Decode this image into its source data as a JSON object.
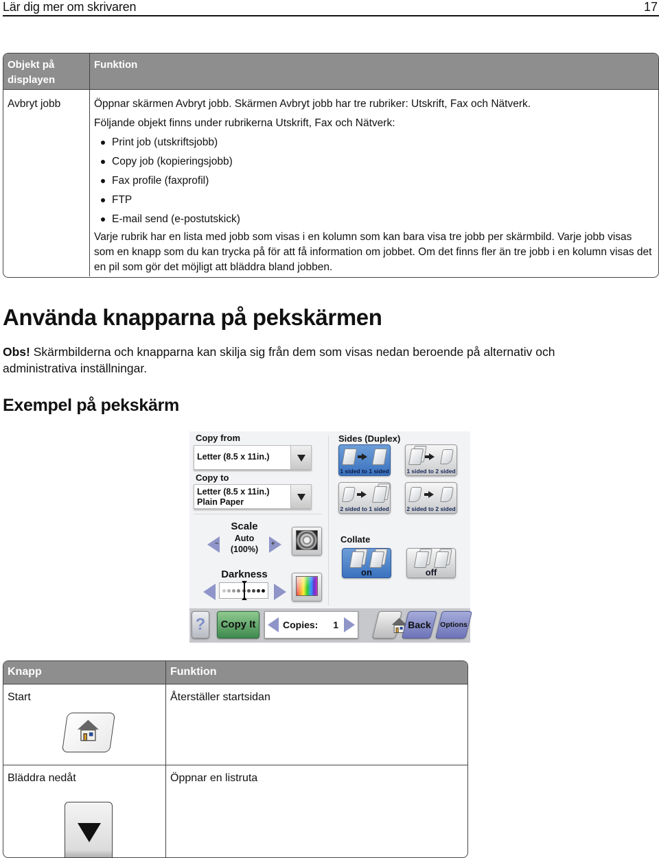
{
  "header": {
    "title": "Lär dig mer om skrivaren",
    "page_number": "17"
  },
  "table1": {
    "columns": [
      "Objekt på displayen",
      "Funktion"
    ],
    "rows": [
      {
        "item": "Avbryt jobb",
        "intro": "Öppnar skärmen Avbryt jobb. Skärmen Avbryt jobb har tre rubriker: Utskrift, Fax och Nätverk.",
        "list_intro": "Följande objekt finns under rubrikerna Utskrift, Fax och Nätverk:",
        "bullets": [
          "Print job (utskriftsjobb)",
          "Copy job (kopieringsjobb)",
          "Fax profile (faxprofil)",
          "FTP",
          "E-mail send (e-postutskick)"
        ],
        "outro": "Varje rubrik har en lista med jobb som visas i en kolumn som kan bara visa tre jobb per skärmbild. Varje jobb visas som en knapp som du kan trycka på för att få information om jobbet. Om det finns fler än tre jobb i en kolumn visas det en pil som gör det möjligt att bläddra bland jobben."
      }
    ]
  },
  "section": {
    "heading": "Använda knapparna på pekskärmen",
    "note_label": "Obs!",
    "note_text": " Skärmbilderna och knapparna kan skilja sig från dem som visas nedan beroende på alternativ och administrativa inställningar.",
    "subheading": "Exempel på pekskärm"
  },
  "touchscreen": {
    "copy_from": {
      "label": "Copy from",
      "value": "Letter (8.5 x 11in.)"
    },
    "copy_to": {
      "label": "Copy to",
      "value_line1": "Letter (8.5 x 11in.)",
      "value_line2": "Plain Paper"
    },
    "sides": {
      "label": "Sides (Duplex)",
      "options": [
        "1 sided to 1 sided",
        "1 sided to 2 sided",
        "2 sided to 1 sided",
        "2 sided to 2 sided"
      ],
      "selected": "1 sided to 1 sided"
    },
    "scale": {
      "label": "Scale",
      "value_line1": "Auto",
      "value_line2": "(100%)",
      "minus": "−",
      "plus": "+"
    },
    "darkness": {
      "label": "Darkness",
      "level": 5,
      "levels": 9
    },
    "collate": {
      "label": "Collate",
      "options": [
        "on",
        "off"
      ],
      "selected": "on"
    },
    "bottom_bar": {
      "help": "?",
      "copy_it": "Copy It",
      "copies_label": "Copies:",
      "copies_value": "1",
      "back": "Back",
      "options": "Options"
    },
    "colors": {
      "selected_blue": "#3a72bf",
      "copy_green": "#3f8a4f",
      "nav_purple": "#6d74b8",
      "arrow_purple": "#8f95c8"
    }
  },
  "table2": {
    "columns": [
      "Knapp",
      "Funktion"
    ],
    "rows": [
      {
        "button": "Start",
        "function": "Återställer startsidan",
        "icon": "home-icon"
      },
      {
        "button": "Bläddra nedåt",
        "function": "Öppnar en listruta",
        "icon": "scroll-down-icon"
      }
    ]
  }
}
